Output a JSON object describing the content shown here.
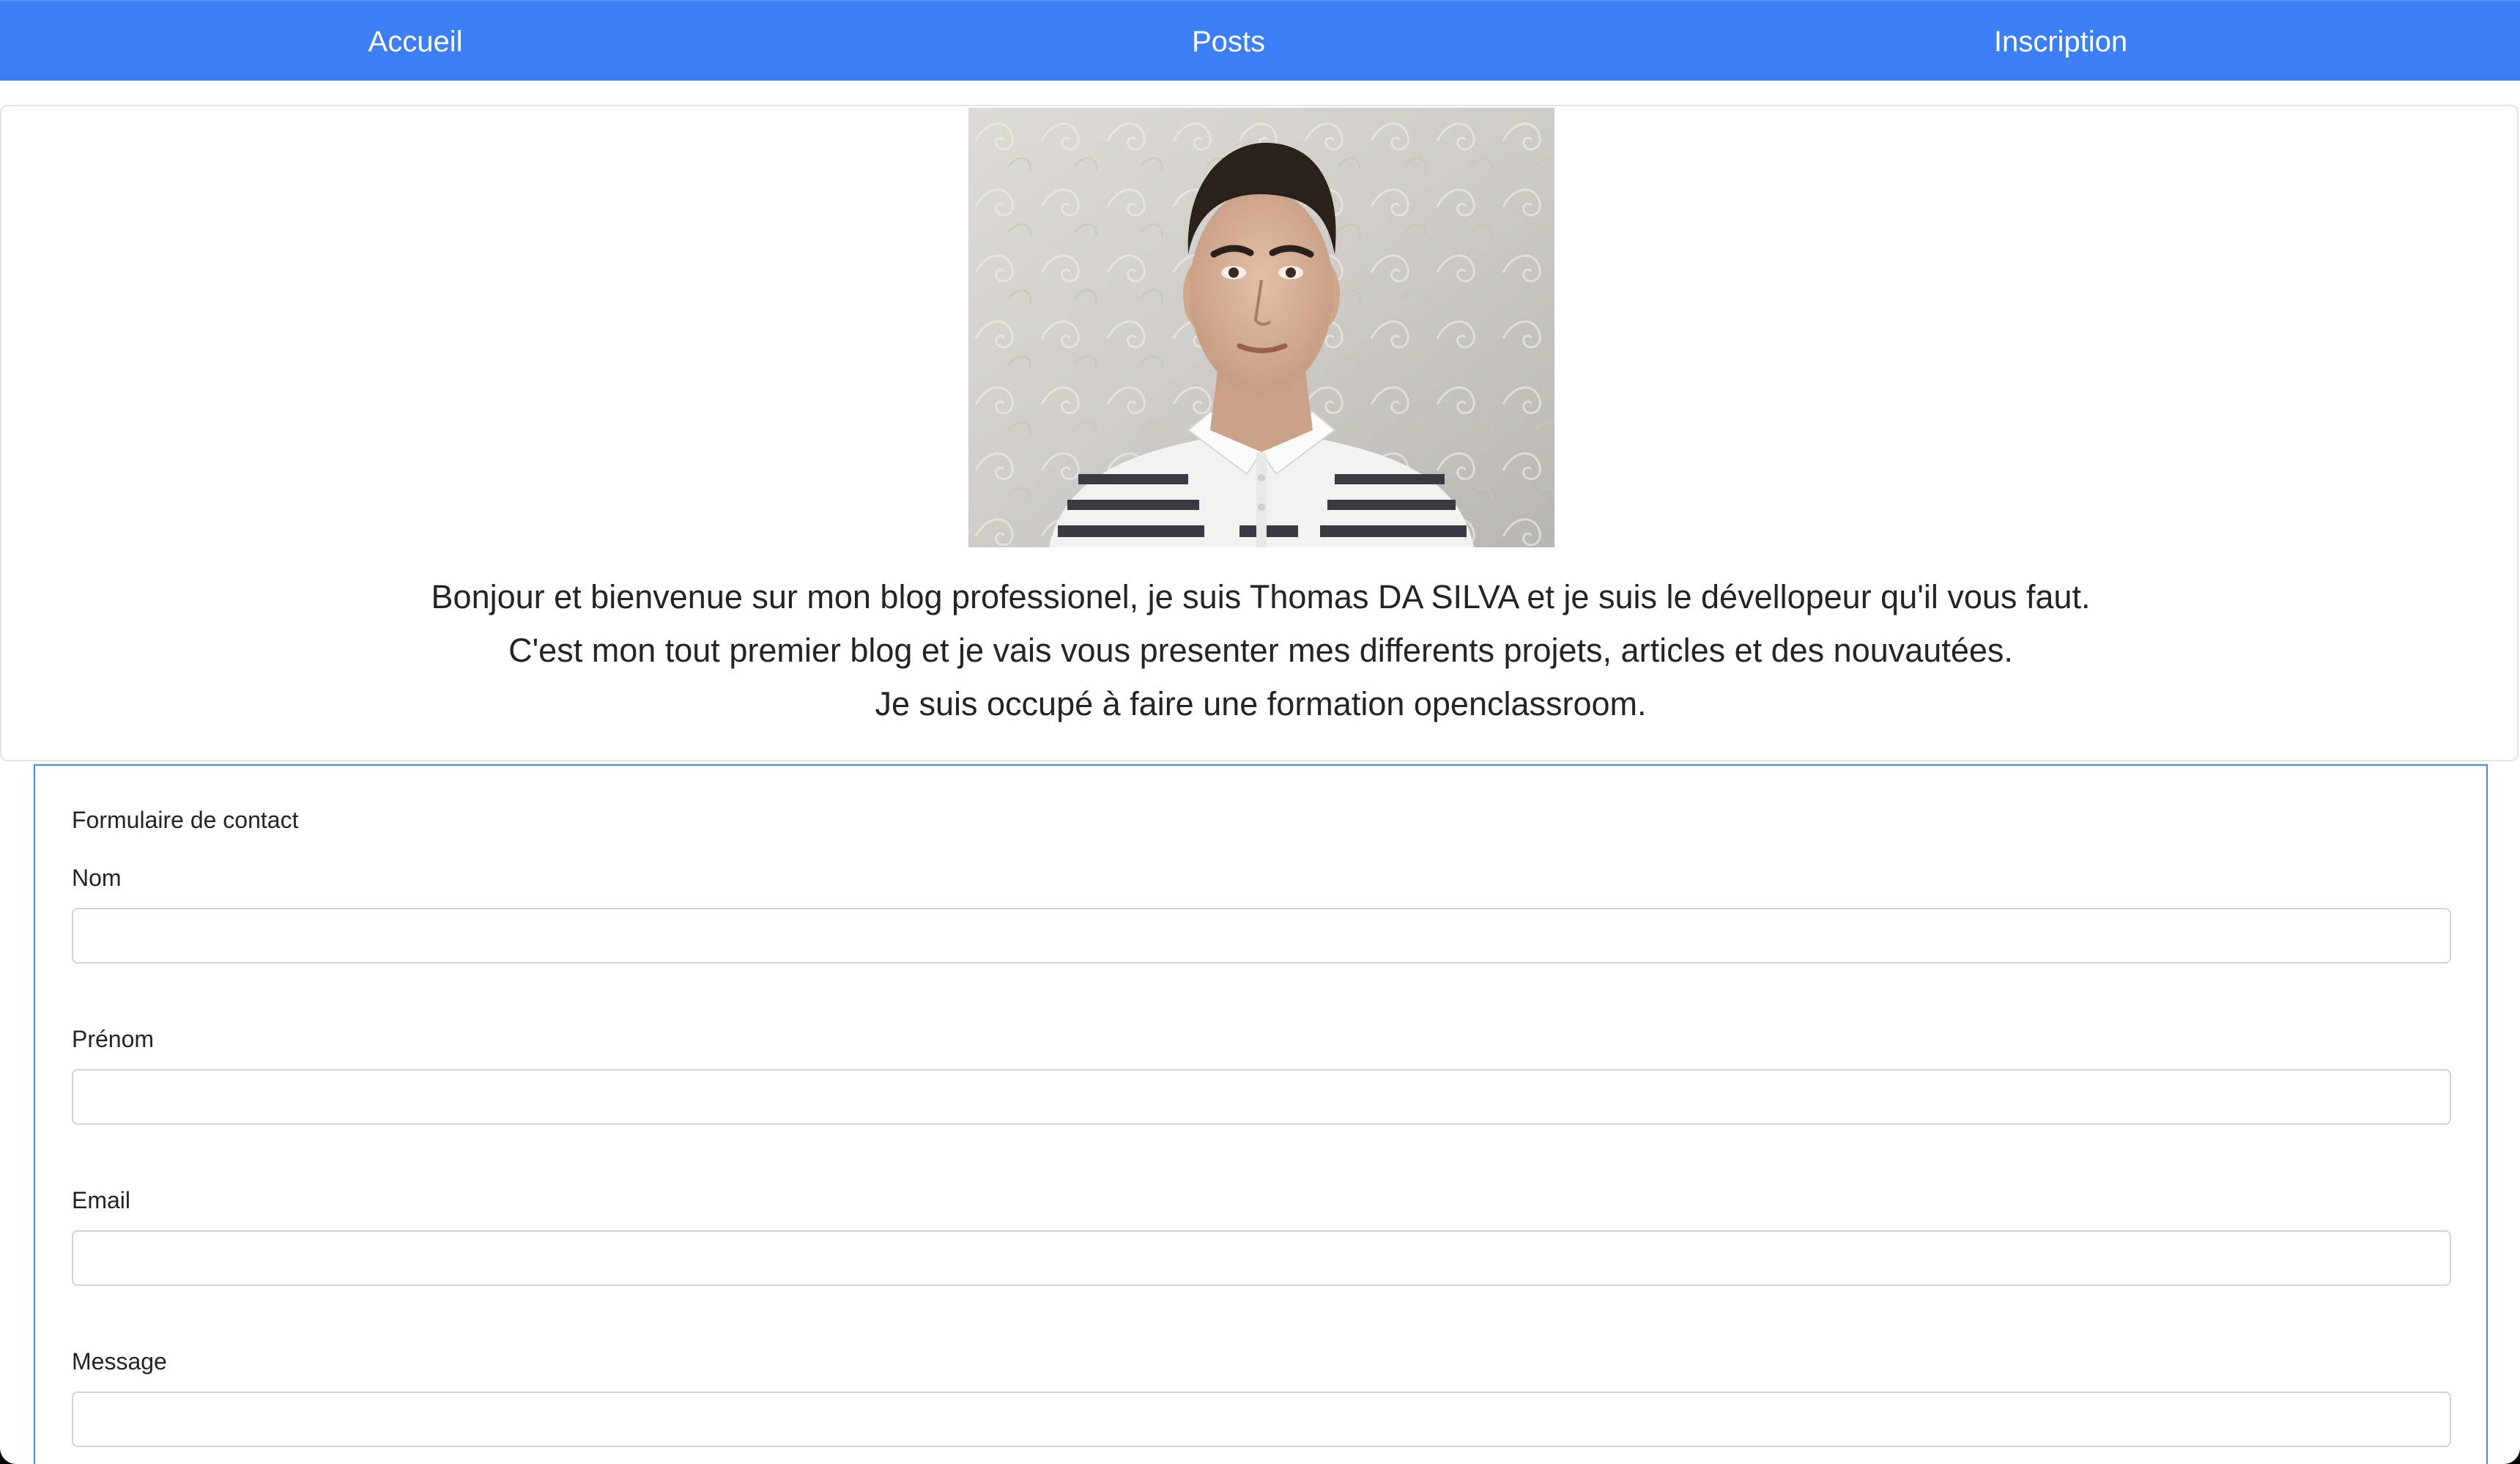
{
  "nav": {
    "items": [
      {
        "label": "Accueil"
      },
      {
        "label": "Posts"
      },
      {
        "label": "Inscription"
      }
    ]
  },
  "colors": {
    "navbar_bg": "#3b7ef6",
    "form_border": "#4a86f0",
    "text": "#212529"
  },
  "hero": {
    "intro_lines": [
      "Bonjour et bienvenue sur mon blog professionel, je suis Thomas DA SILVA et je suis le dévellopeur qu'il vous faut.",
      "C'est mon tout premier blog et je vais vous presenter mes differents projets, articles et des nouvautées.",
      "Je suis occupé à faire une formation openclassroom."
    ]
  },
  "contact_form": {
    "title": "Formulaire de contact",
    "fields": [
      {
        "label": "Nom",
        "value": ""
      },
      {
        "label": "Prénom",
        "value": ""
      },
      {
        "label": "Email",
        "value": ""
      },
      {
        "label": "Message",
        "value": ""
      }
    ]
  }
}
